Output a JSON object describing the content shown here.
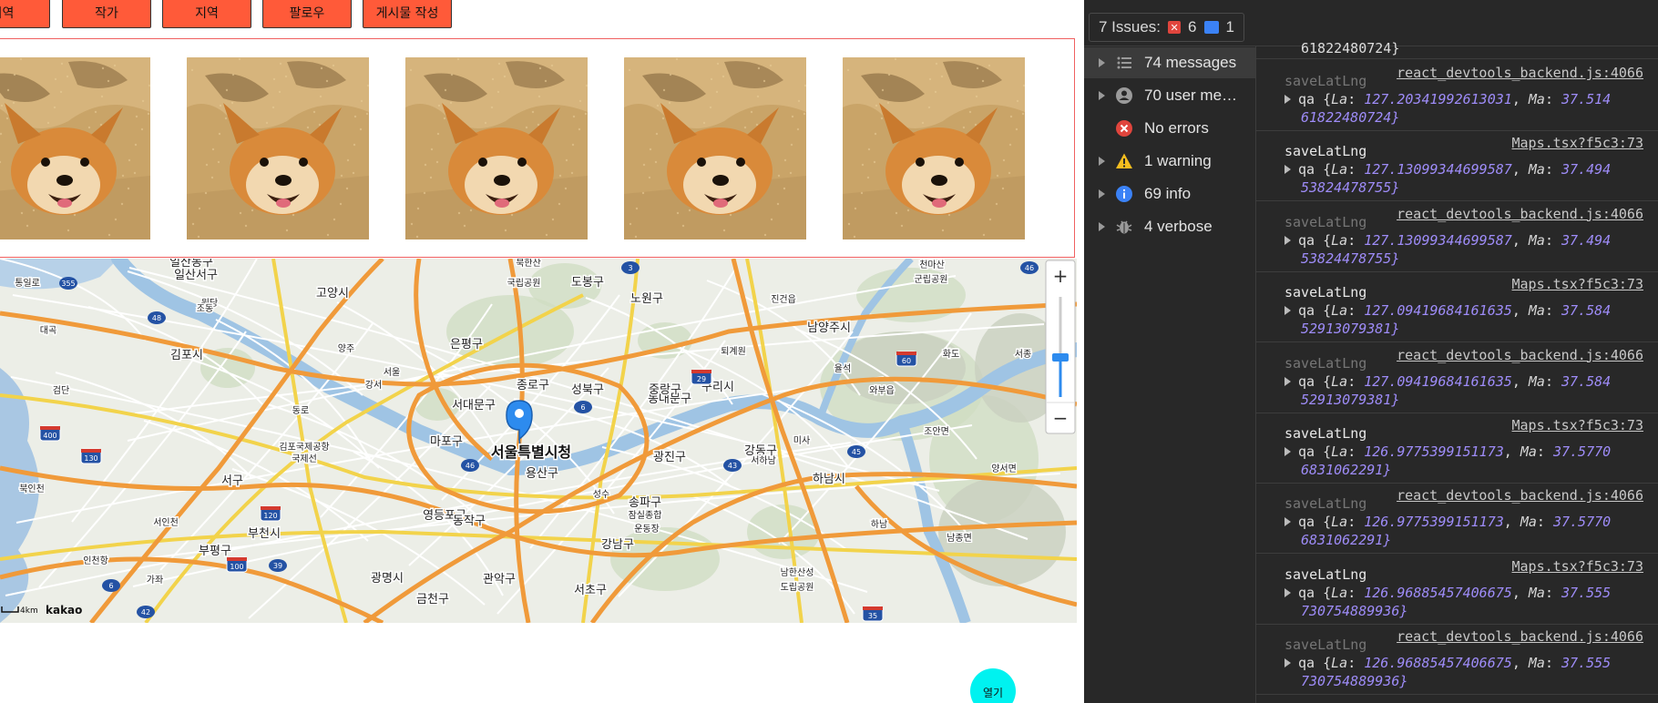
{
  "buttons": [
    "지역",
    "작가",
    "지역",
    "팔로우",
    "게시물 작성"
  ],
  "map": {
    "center_label": "서울특별시청",
    "labels": [
      "일산동구",
      "일산서구",
      "고양시",
      "김포시",
      "북한산",
      "국립공원",
      "도봉구",
      "노원구",
      "진건읍",
      "남양주시",
      "구리시",
      "은평구",
      "종로구",
      "성북구",
      "동대문구",
      "중랑구",
      "서대문구",
      "마포구",
      "용산구",
      "광진구",
      "강동구",
      "하남시",
      "조안면",
      "양서면",
      "영등포구",
      "동작구",
      "강남구",
      "송파구",
      "부천시",
      "광명시",
      "금천구",
      "관악구",
      "서초구",
      "남한산성",
      "도립공원",
      "인천항",
      "미사",
      "서하남",
      "천마산",
      "군립공원",
      "화도",
      "서종",
      "김포국제공항",
      "국제선",
      "잠실종합",
      "운동장",
      "율석",
      "와부읍",
      "퇴계원",
      "검단",
      "대곡",
      "하남",
      "남종면",
      "성수",
      "양주",
      "서울",
      "강서",
      "통일로",
      "북인천",
      "가좌",
      "서인천",
      "부평구",
      "서구",
      "원당",
      "조동",
      "동로"
    ],
    "scale_label": "4km",
    "logo": "kakao",
    "zoom_in": "+",
    "zoom_out": "−"
  },
  "open_button": "열기",
  "devtools": {
    "issues_label": "7 Issues:",
    "issues_errors": "6",
    "issues_info": "1",
    "sidebar": [
      {
        "label": "74 messages",
        "icon": "list-icon",
        "selected": true,
        "arrow": true
      },
      {
        "label": "70 user me…",
        "icon": "user-icon",
        "selected": false,
        "arrow": true
      },
      {
        "label": "No errors",
        "icon": "error-icon",
        "selected": false,
        "arrow": false
      },
      {
        "label": "1 warning",
        "icon": "warning-icon",
        "selected": false,
        "arrow": true
      },
      {
        "label": "69 info",
        "icon": "info-icon",
        "selected": false,
        "arrow": true
      },
      {
        "label": "4 verbose",
        "icon": "bug-icon",
        "selected": false,
        "arrow": true
      }
    ],
    "top_partial": "61822480724}",
    "entries": [
      {
        "src": "react_devtools_backend.js:4066",
        "title": "saveLatLng",
        "faded": true,
        "la": "127.20341992613031",
        "ma_a": "37.514",
        "ma_b": "61822480724}"
      },
      {
        "src": "Maps.tsx?f5c3:73",
        "title": "saveLatLng",
        "faded": false,
        "la": "127.13099344699587",
        "ma_a": "37.494",
        "ma_b": "53824478755}"
      },
      {
        "src": "react_devtools_backend.js:4066",
        "title": "saveLatLng",
        "faded": true,
        "la": "127.13099344699587",
        "ma_a": "37.494",
        "ma_b": "53824478755}"
      },
      {
        "src": "Maps.tsx?f5c3:73",
        "title": "saveLatLng",
        "faded": false,
        "la": "127.09419684161635",
        "ma_a": "37.584",
        "ma_b": "52913079381}"
      },
      {
        "src": "react_devtools_backend.js:4066",
        "title": "saveLatLng",
        "faded": true,
        "la": "127.09419684161635",
        "ma_a": "37.584",
        "ma_b": "52913079381}"
      },
      {
        "src": "Maps.tsx?f5c3:73",
        "title": "saveLatLng",
        "faded": false,
        "la": "126.9775399151173",
        "ma_a": "37.5770",
        "ma_b": "6831062291}"
      },
      {
        "src": "react_devtools_backend.js:4066",
        "title": "saveLatLng",
        "faded": true,
        "la": "126.9775399151173",
        "ma_a": "37.5770",
        "ma_b": "6831062291}"
      },
      {
        "src": "Maps.tsx?f5c3:73",
        "title": "saveLatLng",
        "faded": false,
        "la": "126.96885457406675",
        "ma_a": "37.555",
        "ma_b": "730754889936}"
      },
      {
        "src": "react_devtools_backend.js:4066",
        "title": "saveLatLng",
        "faded": true,
        "la": "126.96885457406675",
        "ma_a": "37.555",
        "ma_b": "730754889936}"
      }
    ]
  }
}
